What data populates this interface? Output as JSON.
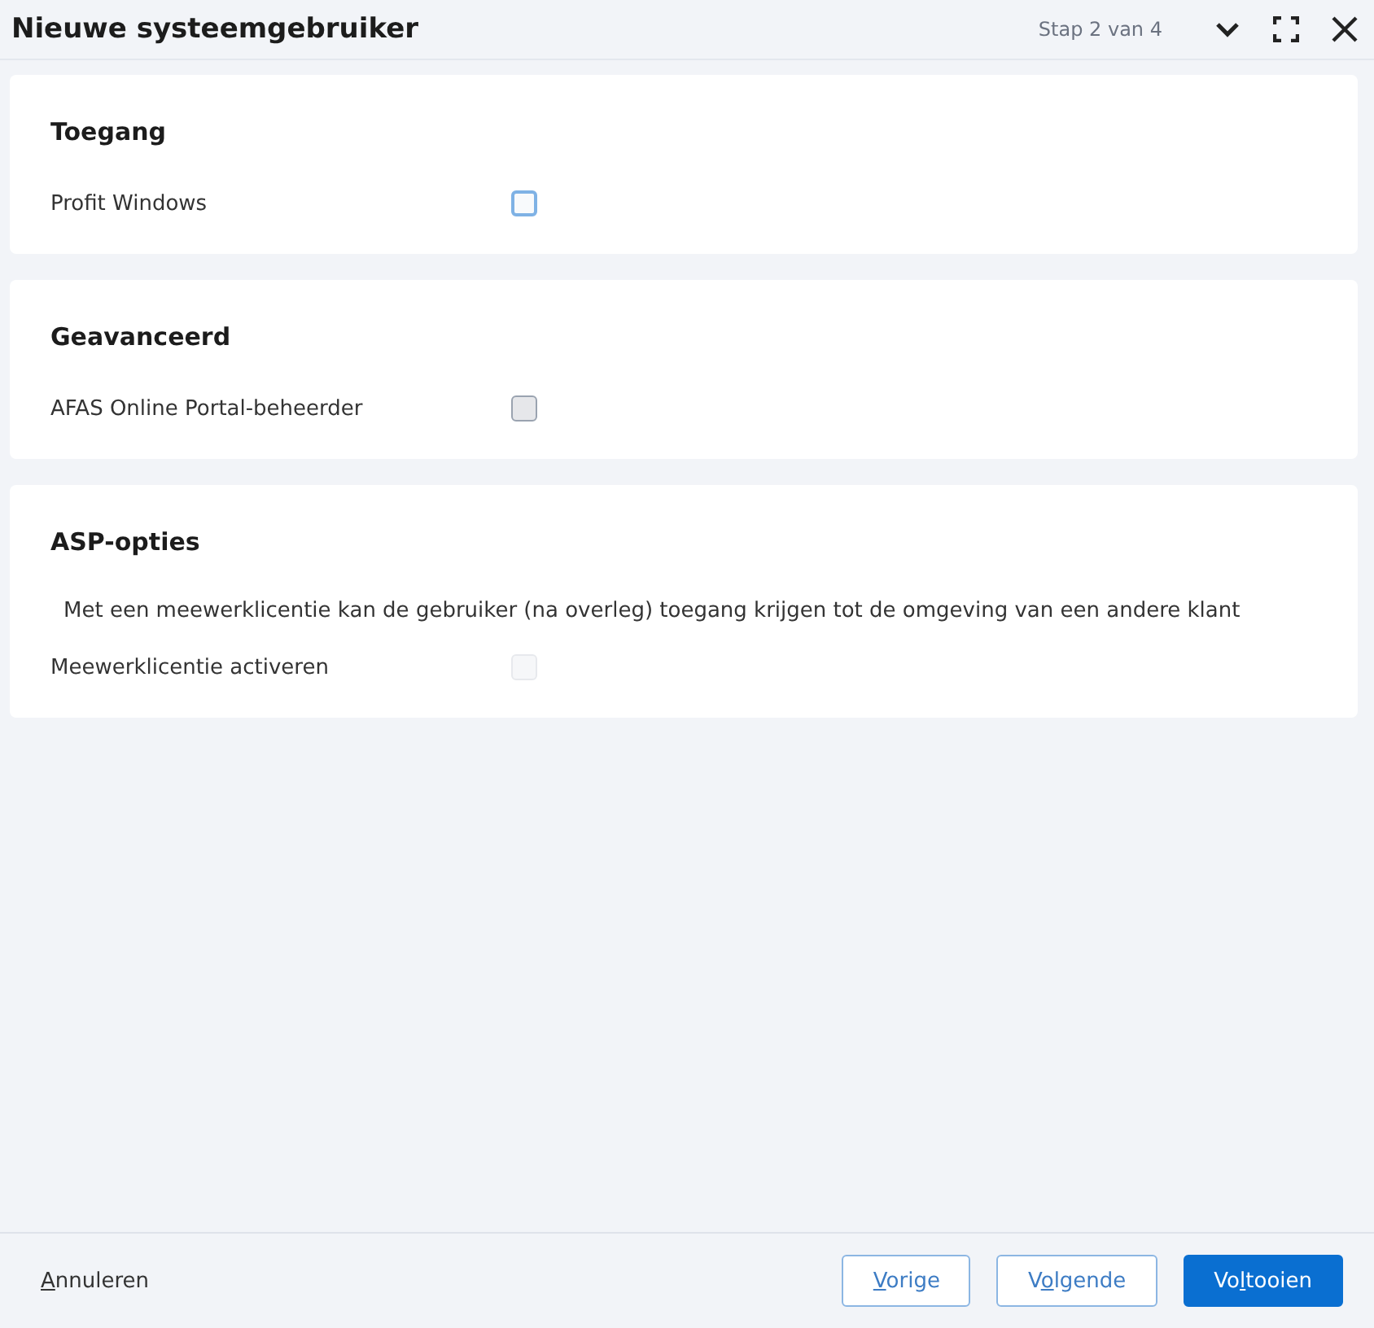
{
  "window": {
    "title": "Nieuwe systeemgebruiker",
    "step": "Stap 2 van 4"
  },
  "sections": [
    {
      "title": "Toegang",
      "rows": [
        {
          "kind": "checkbox",
          "label": "Profit Windows",
          "checked": false,
          "disabled": false
        }
      ]
    },
    {
      "title": "Geavanceerd",
      "rows": [
        {
          "kind": "checkbox",
          "label": "AFAS Online Portal-beheerder",
          "checked": false,
          "disabled": true
        }
      ]
    },
    {
      "title": "ASP-opties",
      "rows": [
        {
          "kind": "note",
          "label": "Met een meewerklicentie kan de gebruiker (na overleg) toegang krijgen tot de omgeving van een andere klant"
        },
        {
          "kind": "checkbox",
          "label": "Meewerklicentie activeren",
          "checked": false,
          "disabled": true
        }
      ]
    }
  ],
  "footer": {
    "cancel": {
      "key": "A",
      "after": "nnuleren"
    },
    "buttons": [
      {
        "kind": "secondary",
        "key": "V",
        "after": "orige"
      },
      {
        "kind": "secondary",
        "before": "V",
        "key": "o",
        "after": "lgende"
      },
      {
        "kind": "primary",
        "before": "Vo",
        "key": "l",
        "after": "tooien"
      }
    ]
  }
}
